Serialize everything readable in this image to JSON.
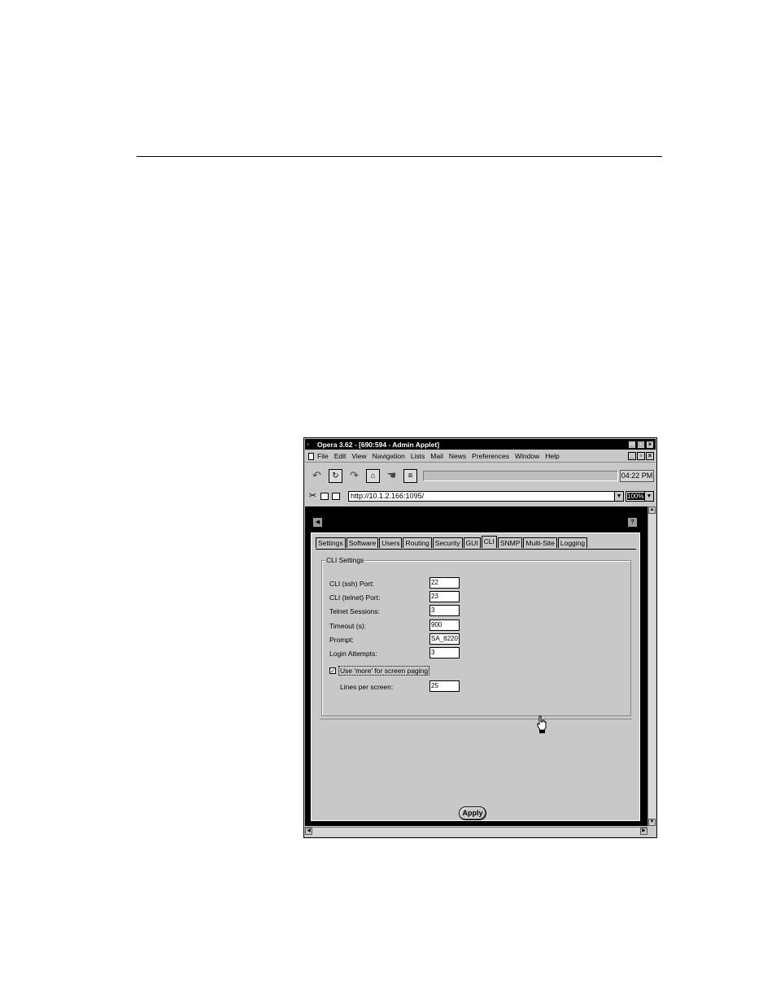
{
  "window": {
    "title": "Opera 3.62 - [690:594 - Admin Applet]"
  },
  "menu": [
    "File",
    "Edit",
    "View",
    "Navigation",
    "Lists",
    "Mail",
    "News",
    "Preferences",
    "Window",
    "Help"
  ],
  "toolbar": {
    "clock": "04:22 PM"
  },
  "address": {
    "url": "http://10.1.2.166:1095/",
    "zoom": "100%"
  },
  "tabs": [
    "Settings",
    "Software",
    "Users",
    "Routing",
    "Security",
    "GUI",
    "CLI",
    "SNMP",
    "Multi-Site",
    "Logging"
  ],
  "active_tab": "CLI",
  "cli": {
    "legend": "CLI Settings",
    "fields": [
      {
        "label": "CLI (ssh) Port:",
        "value": "22"
      },
      {
        "label": "CLI (telnet) Port:",
        "value": "23"
      },
      {
        "label": "Telnet Sessions:",
        "value": "3"
      },
      {
        "label": "Timeout (s):",
        "value": "900"
      },
      {
        "label": "Prompt:",
        "value": "SA_8220"
      },
      {
        "label": "Login Attempts:",
        "value": "3"
      }
    ],
    "paging_label": "Use 'more' for screen paging",
    "paging_checked": true,
    "lines_label": "Lines per screen:",
    "lines_value": "25"
  },
  "apply_label": "Apply",
  "icons": {
    "back": "back-arrow-icon",
    "reload": "reload-icon",
    "forward": "forward-arrow-icon",
    "home": "home-icon",
    "hotlist": "hotlist-icon",
    "print": "print-icon",
    "cursor": "hand-pointer-icon"
  }
}
